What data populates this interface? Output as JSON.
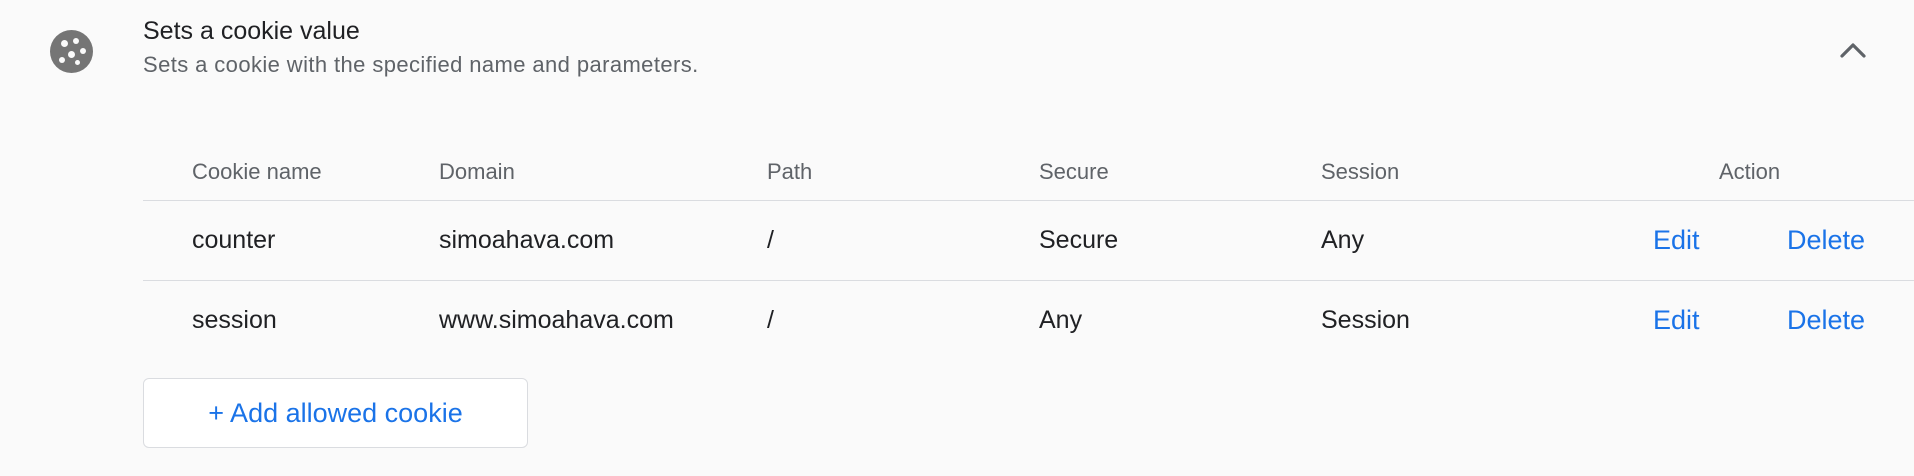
{
  "section": {
    "icon": "cookie-icon",
    "title": "Sets a cookie value",
    "subtitle": "Sets a cookie with the specified name and parameters.",
    "toggle_icon": "chevron-up-icon"
  },
  "table": {
    "columns": [
      "Cookie name",
      "Domain",
      "Path",
      "Secure",
      "Session",
      "Action"
    ],
    "rows": [
      {
        "name": "counter",
        "domain": "simoahava.com",
        "path": "/",
        "secure": "Secure",
        "session": "Any",
        "edit": "Edit",
        "delete": "Delete"
      },
      {
        "name": "session",
        "domain": "www.simoahava.com",
        "path": "/",
        "secure": "Any",
        "session": "Session",
        "edit": "Edit",
        "delete": "Delete"
      }
    ]
  },
  "add_button_label": "+ Add allowed cookie",
  "colors": {
    "link": "#1a73e8",
    "text": "#202124",
    "muted": "#5f6368",
    "icon": "#757575",
    "divider": "#dadce0"
  }
}
